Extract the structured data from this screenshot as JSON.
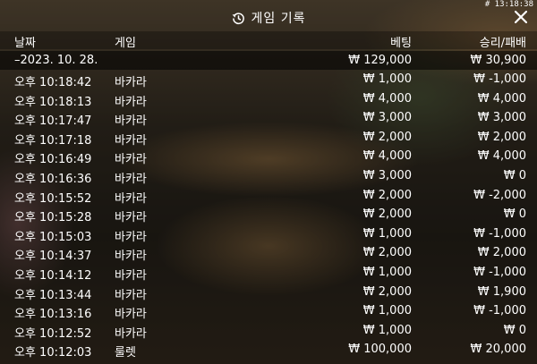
{
  "timestamp": "# 13:18:38",
  "title": "게임 기록",
  "icons": {
    "history": "history-icon",
    "close": "close-icon"
  },
  "columns": {
    "date": "날짜",
    "game": "게임",
    "bet": "베팅",
    "result": "승리/패배"
  },
  "summary": {
    "date": "–2023. 10. 28.",
    "bet": "₩ 129,000",
    "result": "₩ 30,900"
  },
  "rows": [
    {
      "time": "오후 10:18:42",
      "game": "바카라",
      "bet": "₩ 1,000",
      "result": "₩ -1,000"
    },
    {
      "time": "오후 10:18:13",
      "game": "바카라",
      "bet": "₩ 4,000",
      "result": "₩ 4,000"
    },
    {
      "time": "오후 10:17:47",
      "game": "바카라",
      "bet": "₩ 3,000",
      "result": "₩ 3,000"
    },
    {
      "time": "오후 10:17:18",
      "game": "바카라",
      "bet": "₩ 2,000",
      "result": "₩ 2,000"
    },
    {
      "time": "오후 10:16:49",
      "game": "바카라",
      "bet": "₩ 4,000",
      "result": "₩ 4,000"
    },
    {
      "time": "오후 10:16:36",
      "game": "바카라",
      "bet": "₩ 3,000",
      "result": "₩ 0"
    },
    {
      "time": "오후 10:15:52",
      "game": "바카라",
      "bet": "₩ 2,000",
      "result": "₩ -2,000"
    },
    {
      "time": "오후 10:15:28",
      "game": "바카라",
      "bet": "₩ 2,000",
      "result": "₩ 0"
    },
    {
      "time": "오후 10:15:03",
      "game": "바카라",
      "bet": "₩ 1,000",
      "result": "₩ -1,000"
    },
    {
      "time": "오후 10:14:37",
      "game": "바카라",
      "bet": "₩ 2,000",
      "result": "₩ 2,000"
    },
    {
      "time": "오후 10:14:12",
      "game": "바카라",
      "bet": "₩ 1,000",
      "result": "₩ -1,000"
    },
    {
      "time": "오후 10:13:44",
      "game": "바카라",
      "bet": "₩ 2,000",
      "result": "₩ 1,900"
    },
    {
      "time": "오후 10:13:16",
      "game": "바카라",
      "bet": "₩ 1,000",
      "result": "₩ -1,000"
    },
    {
      "time": "오후 10:12:52",
      "game": "바카라",
      "bet": "₩ 1,000",
      "result": "₩ 0"
    },
    {
      "time": "오후 10:12:03",
      "game": "룰렛",
      "bet": "₩ 100,000",
      "result": "₩ 20,000"
    }
  ]
}
